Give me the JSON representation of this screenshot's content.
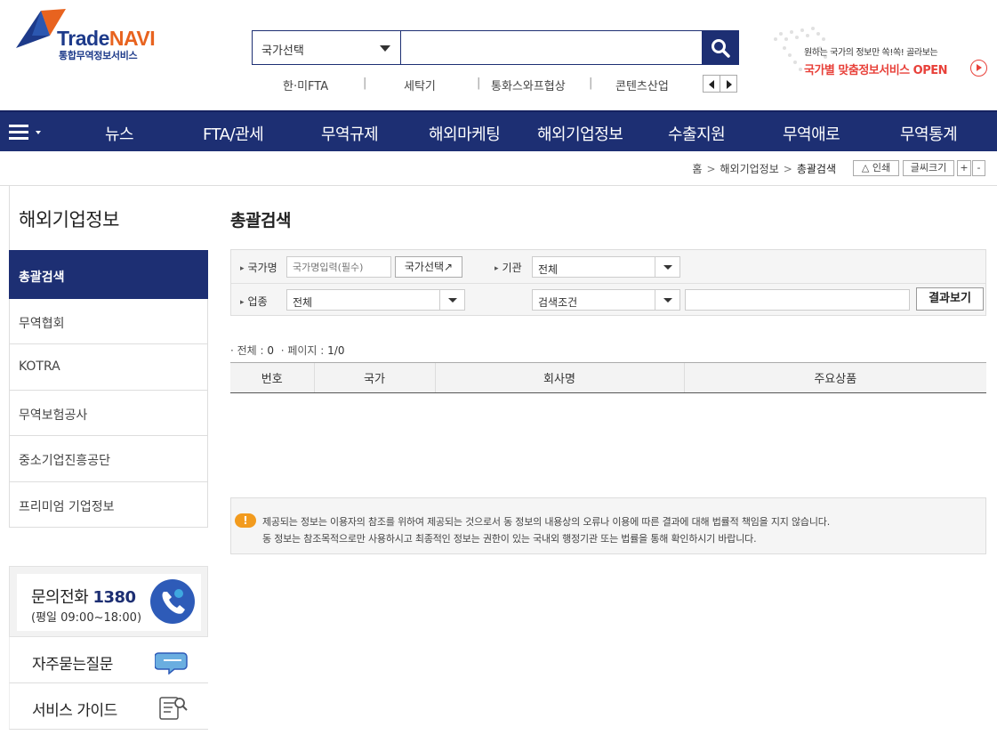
{
  "header": {
    "logo": {
      "brand_a": "Trade",
      "brand_b": "NAVI",
      "sub": "통합무역정보서비스"
    },
    "search": {
      "country_select": "국가선택",
      "placeholder": "",
      "icon": "search-icon"
    },
    "quick_links": [
      "한·미FTA",
      "세탁기",
      "통화스와프협상",
      "콘텐츠산업"
    ],
    "promo": {
      "line1": "원하는 국가의 정보만 쏙!쏙! 골라보는",
      "line2": "국가별 맞춤정보서비스 OPEN"
    }
  },
  "gnb": {
    "items": [
      "뉴스",
      "FTA/관세",
      "무역규제",
      "해외마케팅",
      "해외기업정보",
      "수출지원",
      "무역애로",
      "무역통계"
    ]
  },
  "breadcrumb": {
    "home": "홈",
    "section": "해외기업정보",
    "current": "총괄검색"
  },
  "tools": {
    "print": "인쇄",
    "font_size": "글씨크기",
    "plus": "+",
    "minus": "-"
  },
  "sidebar": {
    "title": "해외기업정보",
    "items": [
      "총괄검색",
      "무역협회",
      "KOTRA",
      "무역보험공사",
      "중소기업진흥공단",
      "프리미엄 기업정보"
    ],
    "active": "총괄검색"
  },
  "help": {
    "call_label": "문의전화",
    "call_number": "1380",
    "call_hours": "(평일 09:00~18:00)",
    "faq": "자주묻는질문",
    "guide": "서비스 가이드"
  },
  "content": {
    "title": "총괄검색",
    "form": {
      "country_label": "국가명",
      "country_placeholder": "국가명입력(필수)",
      "country_button": "국가선택",
      "agency_label": "기관",
      "agency_value": "전체",
      "industry_label": "업종",
      "industry_value": "전체",
      "condition_value": "검색조건",
      "keyword_value": "",
      "submit": "결과보기"
    },
    "summary": {
      "total_label": "전체 :",
      "total": "0",
      "page_label": "페이지 :",
      "page": "1/0"
    },
    "table": {
      "headers": [
        "번호",
        "국가",
        "회사명",
        "주요상품"
      ],
      "rows": []
    },
    "notice": {
      "line1": "제공되는 정보는 이용자의 참조를 위하여 제공되는 것으로서 동 정보의 내용상의 오류나 이용에 따른 결과에 대해 법률적 책임을 지지 않습니다.",
      "line2": "동 정보는 참조목적으로만 사용하시고 최종적인 정보는 권한이 있는 국내외 행정기관 또는 법률을 통해 확인하시기 바랍니다."
    }
  },
  "colors": {
    "primary": "#1d2f73",
    "accent": "#e8631f",
    "promo_red": "#e8413a",
    "warning": "#f29b1e"
  }
}
